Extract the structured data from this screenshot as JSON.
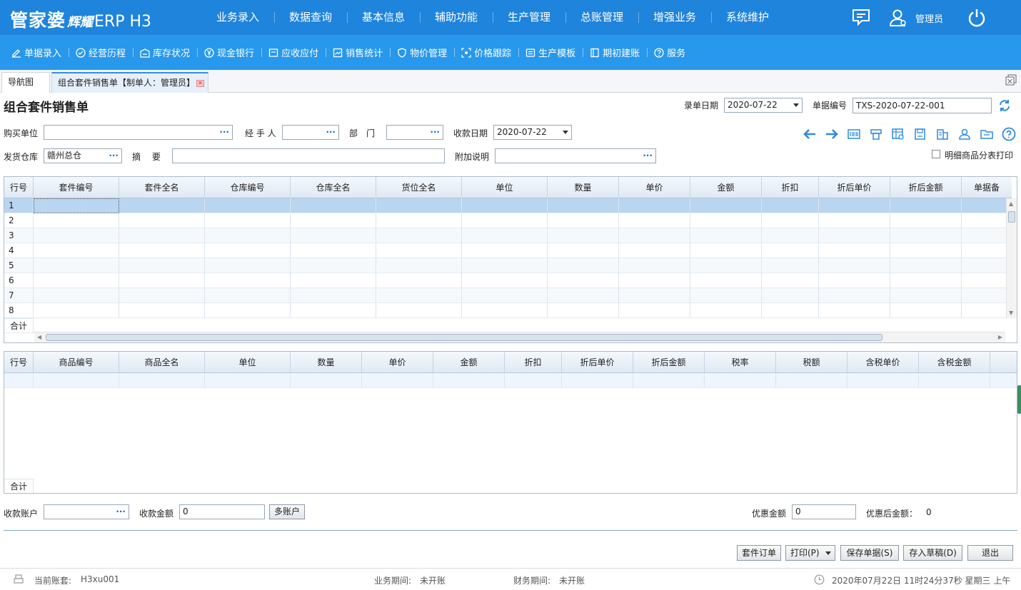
{
  "app": {
    "logo_main": "管家婆",
    "logo_sub": "辉耀",
    "logo_suffix": "ERP H3",
    "brand_color": "#1f84dc",
    "subbar_color": "#2898ec",
    "username": "管理员"
  },
  "main_nav": [
    "业务录入",
    "数据查询",
    "基本信息",
    "辅助功能",
    "生产管理",
    "总账管理",
    "增强业务",
    "系统维护"
  ],
  "sub_nav": [
    {
      "label": "单据录入",
      "icon": "edit-icon"
    },
    {
      "label": "经营历程",
      "icon": "check-circle-icon"
    },
    {
      "label": "库存状况",
      "icon": "warehouse-icon"
    },
    {
      "label": "现金银行",
      "icon": "yuan-icon"
    },
    {
      "label": "应收应付",
      "icon": "ledger-icon"
    },
    {
      "label": "销售统计",
      "icon": "chart-icon"
    },
    {
      "label": "物价管理",
      "icon": "shield-icon"
    },
    {
      "label": "价格跟踪",
      "icon": "track-icon"
    },
    {
      "label": "生产模板",
      "icon": "template-icon"
    },
    {
      "label": "期初建账",
      "icon": "book-icon"
    },
    {
      "label": "服务",
      "icon": "help-icon"
    }
  ],
  "tabs": [
    {
      "label": "导航图"
    },
    {
      "label": "组合套件销售单【制单人：管理员】"
    }
  ],
  "form": {
    "title": "组合套件销售单",
    "entry_date_label": "录单日期",
    "entry_date_value": "2020-07-22",
    "doc_no_label": "单据编号",
    "doc_no_value": "TXS-2020-07-22-001",
    "buyer_label": "购买单位",
    "buyer_value": "",
    "handler_label": "经 手 人",
    "handler_value": "",
    "dept_label": "部　门",
    "dept_value": "",
    "receive_date_label": "收款日期",
    "receive_date_value": "2020-07-22",
    "warehouse_label": "发货仓库",
    "warehouse_value": "赣州总仓",
    "summary_label": "摘　 要",
    "summary_value": "",
    "note_label": "附加说明",
    "note_value": "",
    "detail_print_label": "明细商品分表打印"
  },
  "grid1": {
    "columns": [
      "行号",
      "套件编号",
      "套件全名",
      "仓库编号",
      "仓库全名",
      "货位全名",
      "单位",
      "数量",
      "单价",
      "金额",
      "折扣",
      "折后单价",
      "折后金额",
      "单据备"
    ],
    "rows": [
      "1",
      "2",
      "3",
      "4",
      "5",
      "6",
      "7",
      "8"
    ],
    "total_label": "合计"
  },
  "grid2": {
    "columns": [
      "行号",
      "商品编号",
      "商品全名",
      "单位",
      "数量",
      "单价",
      "金额",
      "折扣",
      "折后单价",
      "折后金额",
      "税率",
      "税额",
      "含税单价",
      "含税金额"
    ],
    "total_label": "合计"
  },
  "payment": {
    "account_label": "收款账户",
    "account_value": "",
    "amount_label": "收款金额",
    "amount_value": "0",
    "multi_account_label": "多账户",
    "discount_label": "优惠金额",
    "discount_value": "0",
    "after_discount_label": "优惠后金额：",
    "after_discount_value": "0"
  },
  "buttons": {
    "kit_order": "套件订单",
    "print": "打印(P)",
    "save": "保存单据(S)",
    "draft": "存入草稿(D)",
    "exit": "退出"
  },
  "status": {
    "account_set_label": "当前账套:",
    "account_set_value": "H3xu001",
    "biz_period_label": "业务期间:",
    "biz_period_value": "未开账",
    "fin_period_label": "财务期间:",
    "fin_period_value": "未开账",
    "datetime": "2020年07月22日 11时24分37秒 星期三 上午"
  }
}
